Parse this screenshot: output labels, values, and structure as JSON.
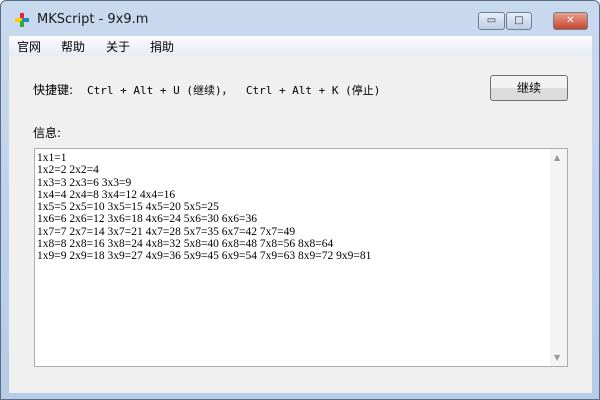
{
  "window": {
    "title": "MKScript - 9x9.m",
    "minimize": "▭",
    "maximize": "□",
    "close": "✕"
  },
  "menu": [
    "官网",
    "帮助",
    "关于",
    "捐助"
  ],
  "hotkey": {
    "label": "快捷键:",
    "text": "Ctrl + Alt + U (继续)，  Ctrl + Alt + K (停止)"
  },
  "continue_button": "继续",
  "info_label": "信息:",
  "output_lines": [
    "1x1=1",
    "1x2=2 2x2=4",
    "1x3=3 2x3=6 3x3=9",
    "1x4=4 2x4=8 3x4=12 4x4=16",
    "1x5=5 2x5=10 3x5=15 4x5=20 5x5=25",
    "1x6=6 2x6=12 3x6=18 4x6=24 5x6=30 6x6=36",
    "1x7=7 2x7=14 3x7=21 4x7=28 5x7=35 6x7=42 7x7=49",
    "1x8=8 2x8=16 3x8=24 4x8=32 5x8=40 6x8=48 7x8=56 8x8=64",
    "1x9=9 2x9=18 3x9=27 4x9=36 5x9=45 6x9=54 7x9=63 8x9=72 9x9=81"
  ],
  "scroll": {
    "up": "▲",
    "down": "▼"
  }
}
